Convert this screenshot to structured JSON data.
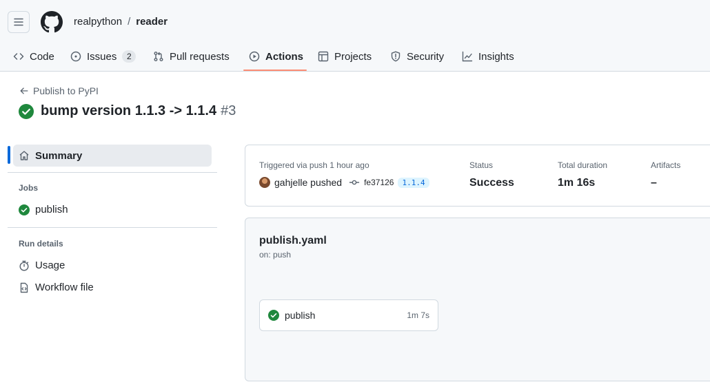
{
  "repo": {
    "owner": "realpython",
    "separator": "/",
    "name": "reader"
  },
  "tabs": [
    {
      "label": "Code",
      "icon": "code-icon"
    },
    {
      "label": "Issues",
      "icon": "issue-opened-icon",
      "counter": "2"
    },
    {
      "label": "Pull requests",
      "icon": "git-pull-request-icon"
    },
    {
      "label": "Actions",
      "icon": "play-icon",
      "active": true
    },
    {
      "label": "Projects",
      "icon": "table-icon"
    },
    {
      "label": "Security",
      "icon": "shield-icon"
    },
    {
      "label": "Insights",
      "icon": "graph-icon"
    }
  ],
  "run": {
    "back_label": "Publish to PyPI",
    "title": "bump version 1.1.3 -> 1.1.4",
    "number": "#3"
  },
  "sidebar": {
    "summary_label": "Summary",
    "jobs_heading": "Jobs",
    "jobs": [
      {
        "label": "publish"
      }
    ],
    "run_details_heading": "Run details",
    "details": [
      {
        "label": "Usage",
        "icon": "stopwatch-icon"
      },
      {
        "label": "Workflow file",
        "icon": "file-code-icon"
      }
    ]
  },
  "summary": {
    "trigger_label": "Triggered via push 1 hour ago",
    "actor": "gahjelle pushed",
    "commit": "fe37126",
    "tag": "1.1.4",
    "status_label": "Status",
    "status_value": "Success",
    "duration_label": "Total duration",
    "duration_value": "1m 16s",
    "artifacts_label": "Artifacts",
    "artifacts_value": "–"
  },
  "workflow": {
    "file": "publish.yaml",
    "trigger": "on: push",
    "jobs": [
      {
        "name": "publish",
        "duration": "1m 7s"
      }
    ]
  },
  "colors": {
    "success": "#1f883d",
    "accent": "#0969da",
    "tab_underline": "#fd8c73"
  }
}
